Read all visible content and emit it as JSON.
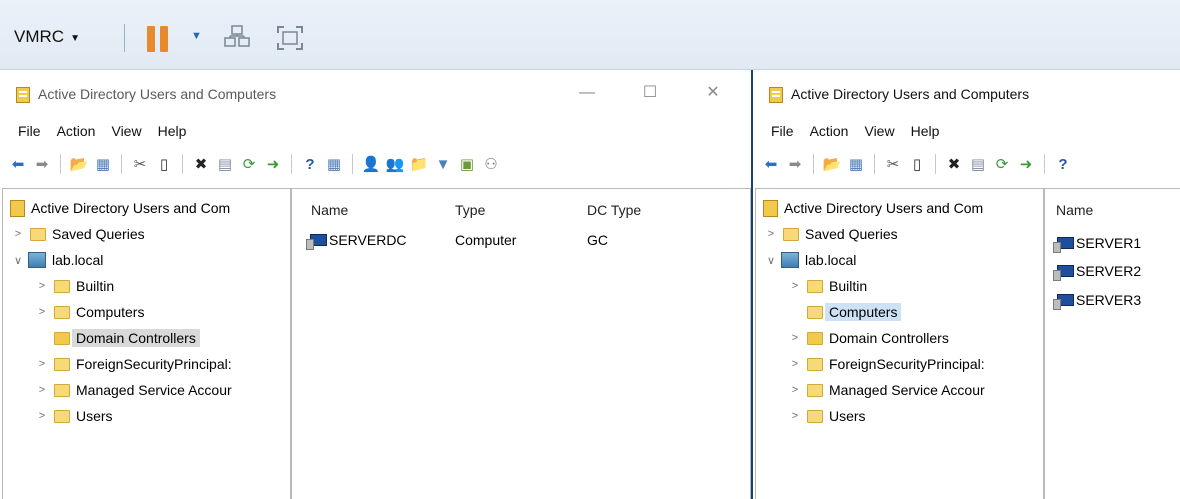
{
  "vmrc": {
    "menu_label": "VMRC"
  },
  "left_window": {
    "title": "Active Directory Users and Computers",
    "menu": [
      "File",
      "Action",
      "View",
      "Help"
    ],
    "tree": {
      "root": "Active Directory Users and Com",
      "items": [
        "Saved Queries",
        "lab.local",
        "Builtin",
        "Computers",
        "Domain Controllers",
        "ForeignSecurityPrincipal:",
        "Managed Service Accour",
        "Users"
      ]
    },
    "columns": [
      "Name",
      "Type",
      "DC Type"
    ],
    "rows": [
      {
        "name": "SERVERDC",
        "type": "Computer",
        "dc_type": "GC"
      }
    ]
  },
  "right_window": {
    "title": "Active Directory Users and Computers",
    "menu": [
      "File",
      "Action",
      "View",
      "Help"
    ],
    "tree": {
      "root": "Active Directory Users and Com",
      "items": [
        "Saved Queries",
        "lab.local",
        "Builtin",
        "Computers",
        "Domain Controllers",
        "ForeignSecurityPrincipal:",
        "Managed Service Accour",
        "Users"
      ]
    },
    "columns": [
      "Name"
    ],
    "rows": [
      "SERVER1",
      "SERVER2",
      "SERVER3"
    ]
  },
  "colors": {
    "selection": "#cde3f5",
    "selection_inactive": "#d9d9d9",
    "divider": "#1b3f73",
    "pause": "#e88a2a"
  }
}
